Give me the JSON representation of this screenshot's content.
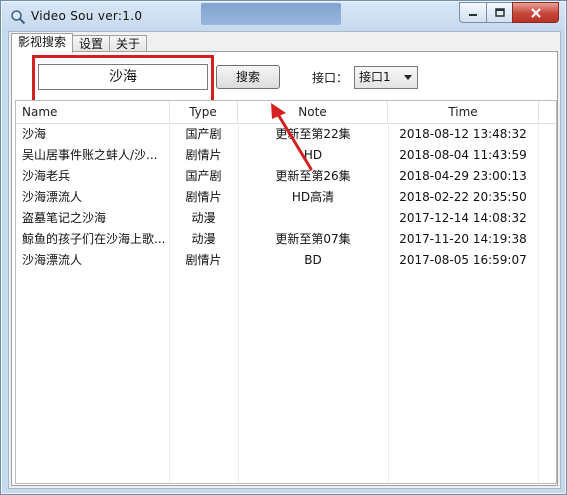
{
  "window": {
    "title": "Video Sou  ver:1.0"
  },
  "tabs": [
    {
      "label": "影视搜索"
    },
    {
      "label": "设置"
    },
    {
      "label": "关于"
    }
  ],
  "search": {
    "value": "沙海",
    "button_label": "搜索"
  },
  "api": {
    "label": "接口：",
    "selected": "接口1"
  },
  "table": {
    "columns": [
      "Name",
      "Type",
      "Note",
      "Time"
    ],
    "rows": [
      {
        "name": "沙海",
        "type": "国产剧",
        "note": "更新至第22集",
        "time": "2018-08-12 13:48:32"
      },
      {
        "name": "吴山居事件账之蚌人/沙...",
        "type": "剧情片",
        "note": "HD",
        "time": "2018-08-04 11:43:59"
      },
      {
        "name": "沙海老兵",
        "type": "国产剧",
        "note": "更新至第26集",
        "time": "2018-04-29 23:00:13"
      },
      {
        "name": "沙海漂流人",
        "type": "剧情片",
        "note": "HD高清",
        "time": "2018-02-22 20:35:50"
      },
      {
        "name": "盗墓笔记之沙海",
        "type": "动漫",
        "note": "",
        "time": "2017-12-14 14:08:32"
      },
      {
        "name": "鲸鱼的孩子们在沙海上歌...",
        "type": "动漫",
        "note": "更新至第07集",
        "time": "2017-11-20 14:19:38"
      },
      {
        "name": "沙海漂流人",
        "type": "剧情片",
        "note": "BD",
        "time": "2017-08-05 16:59:07"
      }
    ]
  },
  "colors": {
    "highlight_box": "#d42020",
    "annotation_arrow": "#d42020",
    "close_button": "#c7463a"
  },
  "icons": {
    "app": "magnifier-icon",
    "minimize": "minimize-icon",
    "maximize": "maximize-icon",
    "close": "close-icon",
    "dropdown": "chevron-down-icon"
  }
}
